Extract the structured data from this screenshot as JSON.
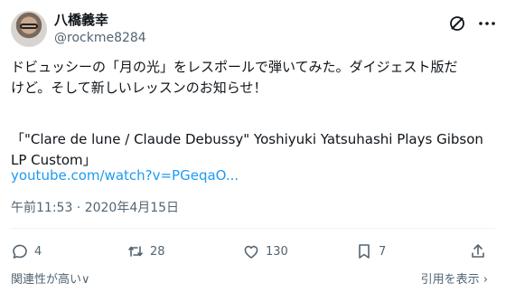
{
  "author": {
    "name": "八橋義幸",
    "handle": "@rockme8284"
  },
  "tweet": {
    "line1": "ドビュッシーの「月の光」をレスポールで弾いてみた。ダイジェスト版だ",
    "line2": "けど。そして新しいレッスンのお知らせ！",
    "quote": "「\"Clare de lune / Claude Debussy\" Yoshiyuki Yatsuhashi Plays Gibson LP Custom」",
    "link": "youtube.com/watch?v=PGeqaO..."
  },
  "timestamp": "午前11:53 · 2020年4月15日",
  "actions": {
    "replies": "4",
    "retweets": "28",
    "likes": "130",
    "bookmarks": "7"
  },
  "footer": {
    "sort_label": "関連性が高い",
    "view_quotes": "引用を表示",
    "chevron": "∨",
    "arrow": "›"
  },
  "icons": [
    "grok-icon",
    "more-icon",
    "reply-icon",
    "retweet-icon",
    "like-icon",
    "bookmark-icon",
    "share-icon",
    "chevron-down-icon",
    "chevron-right-icon"
  ],
  "colors": {
    "text": "#0f1419",
    "secondary": "#536471",
    "link": "#1d9bf0",
    "divider": "#eff3f4"
  }
}
